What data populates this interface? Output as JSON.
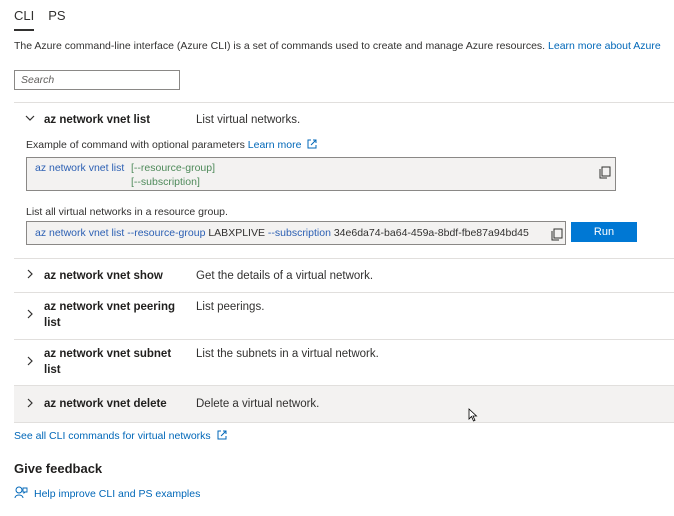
{
  "tabs": [
    {
      "label": "CLI",
      "active": true
    },
    {
      "label": "PS",
      "active": false
    }
  ],
  "intro": {
    "text": "The Azure command-line interface (Azure CLI) is a set of commands used to create and manage Azure resources.",
    "link": "Learn more about Azure"
  },
  "search": {
    "placeholder": "Search",
    "value": ""
  },
  "commands": [
    {
      "name": "az network vnet list",
      "description": "List virtual networks.",
      "expanded": true,
      "example_label": "Example of command with optional parameters",
      "learn_more": "Learn more",
      "example_cmd": "az network vnet list",
      "example_params": [
        "[--resource-group]",
        "[--subscription]"
      ],
      "list_label": "List all virtual networks in a resource group.",
      "run_cmd": "az network vnet list",
      "run_flag1": "--resource-group",
      "run_val1": "LABXPLIVE",
      "run_flag2": "--subscription",
      "run_val2": "34e6da74-ba64-459a-8bdf-fbe87a94bd45",
      "run_label": "Run"
    },
    {
      "name": "az network vnet show",
      "description": "Get the details of a virtual network."
    },
    {
      "name_line1": "az network vnet peering",
      "name_line2": "list",
      "description": "List peerings."
    },
    {
      "name_line1": "az network vnet subnet",
      "name_line2": "list",
      "description": "List the subnets in a virtual network."
    },
    {
      "name": "az network vnet delete",
      "description": "Delete a virtual network."
    }
  ],
  "see_all": "See all CLI commands for virtual networks",
  "feedback": {
    "title": "Give feedback",
    "link": "Help improve CLI and PS examples"
  },
  "icons": {
    "chevron_down": "chevron-down-icon",
    "chevron_right": "chevron-right-icon",
    "copy": "copy-icon",
    "external": "external-link-icon",
    "feedback": "feedback-icon"
  },
  "colors": {
    "link": "#0067b8",
    "run_button": "#0078d4",
    "code_bg": "#f3f2f1",
    "param_green": "#4e8a5a",
    "cmd_blue": "#2b5fb3"
  }
}
